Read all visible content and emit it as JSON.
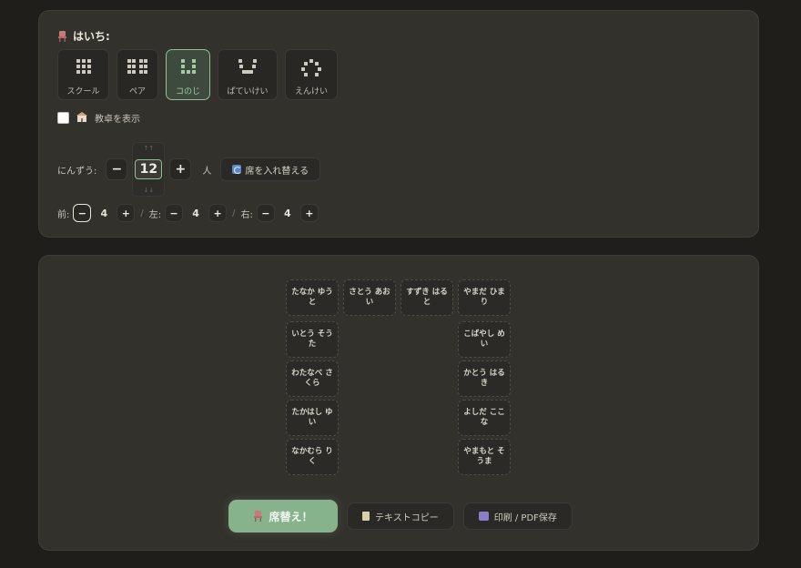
{
  "settings": {
    "title": "はいち:",
    "layouts": [
      {
        "label": "スクール",
        "icon": "school-grid-icon",
        "active": false
      },
      {
        "label": "ペア",
        "icon": "pair-grid-icon",
        "active": false
      },
      {
        "label": "コのじ",
        "icon": "u-shape-icon",
        "active": true
      },
      {
        "label": "ぱていけい",
        "icon": "trapezoid-icon",
        "active": false
      },
      {
        "label": "えんけい",
        "icon": "circle-icon",
        "active": false
      }
    ],
    "show_desk_label": "教卓を表示",
    "show_desk_checked": false,
    "count_label": "にんずう:",
    "count_value": "12",
    "count_unit": "人",
    "minus": "−",
    "plus": "+",
    "shuffle_label": "席を入れ替える",
    "front_label": "前:",
    "front_value": "4",
    "left_label": "左:",
    "left_value": "4",
    "right_label": "右:",
    "right_value": "4",
    "separator": "/"
  },
  "seats": [
    "たなか ゆうと",
    "さとう あおい",
    "すずき はると",
    "やまだ ひまり",
    "いとう そうた",
    "こばやし めい",
    "わたなべ さくら",
    "かとう はるき",
    "たかはし ゆい",
    "よしだ ここな",
    "なかむら りく",
    "やまもと そうま"
  ],
  "actions": {
    "shuffle_label": "席替え！",
    "copy_label": "テキストコピー",
    "print_label": "印刷 / PDF保存"
  },
  "colors": {
    "accent": "#86b38b",
    "panel": "#33312c",
    "background": "#1f1e1b"
  }
}
